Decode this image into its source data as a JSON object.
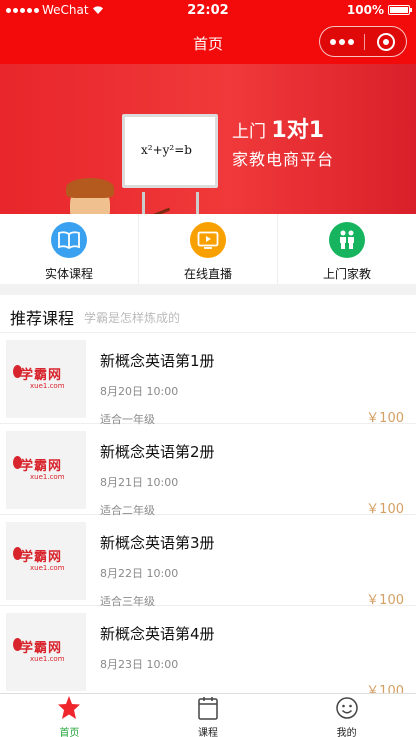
{
  "status_bar": {
    "carrier": "WeChat",
    "time": "22:02",
    "battery": "100%"
  },
  "nav": {
    "title": "首页"
  },
  "banner": {
    "line1_prefix": "上门",
    "line1_highlight": "1对1",
    "line2": "家教电商平台",
    "formula": "x²+y²=b",
    "slide_count": 3,
    "active_slide": 1
  },
  "quick_links": [
    {
      "label": "实体课程",
      "icon": "book-icon",
      "color": "#3aa1f0"
    },
    {
      "label": "在线直播",
      "icon": "video-play-icon",
      "color": "#f7a000"
    },
    {
      "label": "上门家教",
      "icon": "people-icon",
      "color": "#16b45e"
    }
  ],
  "section": {
    "title": "推荐课程",
    "subtitle": "学霸是怎样炼成的"
  },
  "courses": [
    {
      "title": "新概念英语第1册",
      "date": "8月20日 10:00",
      "grade": "适合一年级",
      "price": "￥100"
    },
    {
      "title": "新概念英语第2册",
      "date": "8月21日 10:00",
      "grade": "适合二年级",
      "price": "￥100"
    },
    {
      "title": "新概念英语第3册",
      "date": "8月22日 10:00",
      "grade": "适合三年级",
      "price": "￥100"
    },
    {
      "title": "新概念英语第4册",
      "date": "8月23日 10:00",
      "grade": "",
      "price": "￥100"
    }
  ],
  "thumb_logo": {
    "cn": "学霸网",
    "en": "xue1.com"
  },
  "tabs": [
    {
      "label": "首页",
      "icon": "star-icon",
      "active": true
    },
    {
      "label": "课程",
      "icon": "calendar-icon",
      "active": false
    },
    {
      "label": "我的",
      "icon": "smiley-icon",
      "active": false
    }
  ],
  "colors": {
    "brand_red": "#f30a0a",
    "price": "#d4a064",
    "tab_active": "#22a53a"
  }
}
